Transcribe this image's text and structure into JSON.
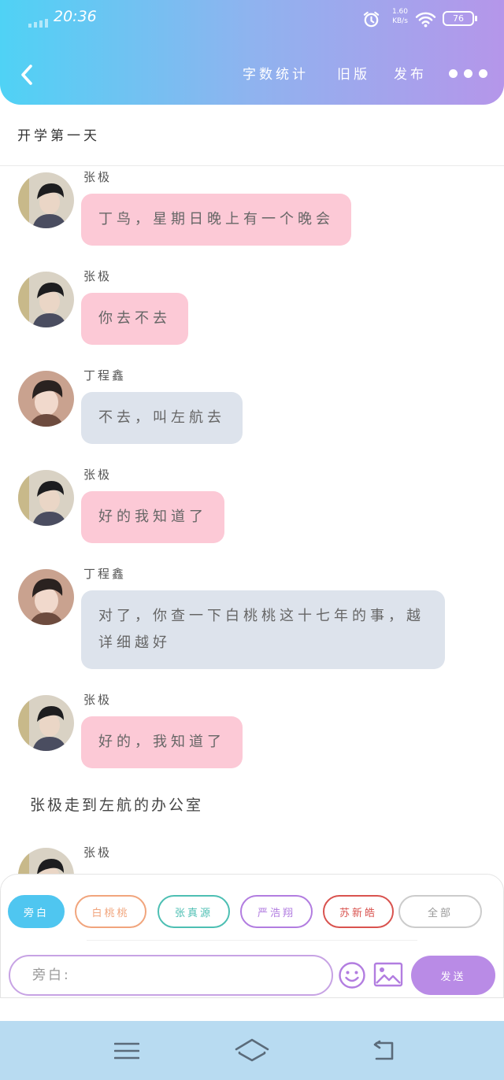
{
  "status_bar": {
    "time": "20:36",
    "net_speed": "1.60",
    "net_unit": "KB/s",
    "battery": "76"
  },
  "header": {
    "back_icon": "chevron-left-icon",
    "actions": [
      "字数统计",
      "旧版",
      "发布"
    ],
    "more_icon": "more-dots-icon"
  },
  "story": {
    "title": "开学第一天"
  },
  "messages": [
    {
      "sender": "张极",
      "text": "丁鸟，星期日晚上有一个晚会",
      "style": "pink"
    },
    {
      "sender": "张极",
      "text": "你去不去",
      "style": "pink"
    },
    {
      "sender": "丁程鑫",
      "text": "不去，叫左航去",
      "style": "grey"
    },
    {
      "sender": "张极",
      "text": "好的我知道了",
      "style": "pink"
    },
    {
      "sender": "丁程鑫",
      "text": "对了，你查一下白桃桃这十七年的事，越详细越好",
      "style": "grey"
    },
    {
      "sender": "张极",
      "text": "好的，我知道了",
      "style": "pink"
    }
  ],
  "narration": "张极走到左航的办公室",
  "partial_message": {
    "sender": "张极"
  },
  "roles": [
    {
      "label": "旁白",
      "color": "#4fc6f0",
      "active": true
    },
    {
      "label": "白桃桃",
      "color": "#f1a57d",
      "active": false
    },
    {
      "label": "张真源",
      "color": "#4dbfb3",
      "active": false
    },
    {
      "label": "严浩翔",
      "color": "#b27de0",
      "active": false
    },
    {
      "label": "苏新皓",
      "color": "#d9534f",
      "active": false
    },
    {
      "label": "全部",
      "color": "#cccccc",
      "active": false
    }
  ],
  "input": {
    "placeholder": "旁白:"
  },
  "buttons": {
    "send": "发送",
    "emoji_icon": "smiley-icon",
    "image_icon": "image-icon"
  },
  "system_nav": {
    "menu_icon": "menu-icon",
    "home_icon": "home-icon",
    "back_icon": "back-arrow-icon"
  },
  "colors": {
    "header_start": "#4fd2f5",
    "header_end": "#b596ea",
    "bubble_pink": "#fcc9d6",
    "bubble_grey": "#dde3ec",
    "send_button": "#b98be6",
    "system_nav": "#b8dbf1"
  }
}
